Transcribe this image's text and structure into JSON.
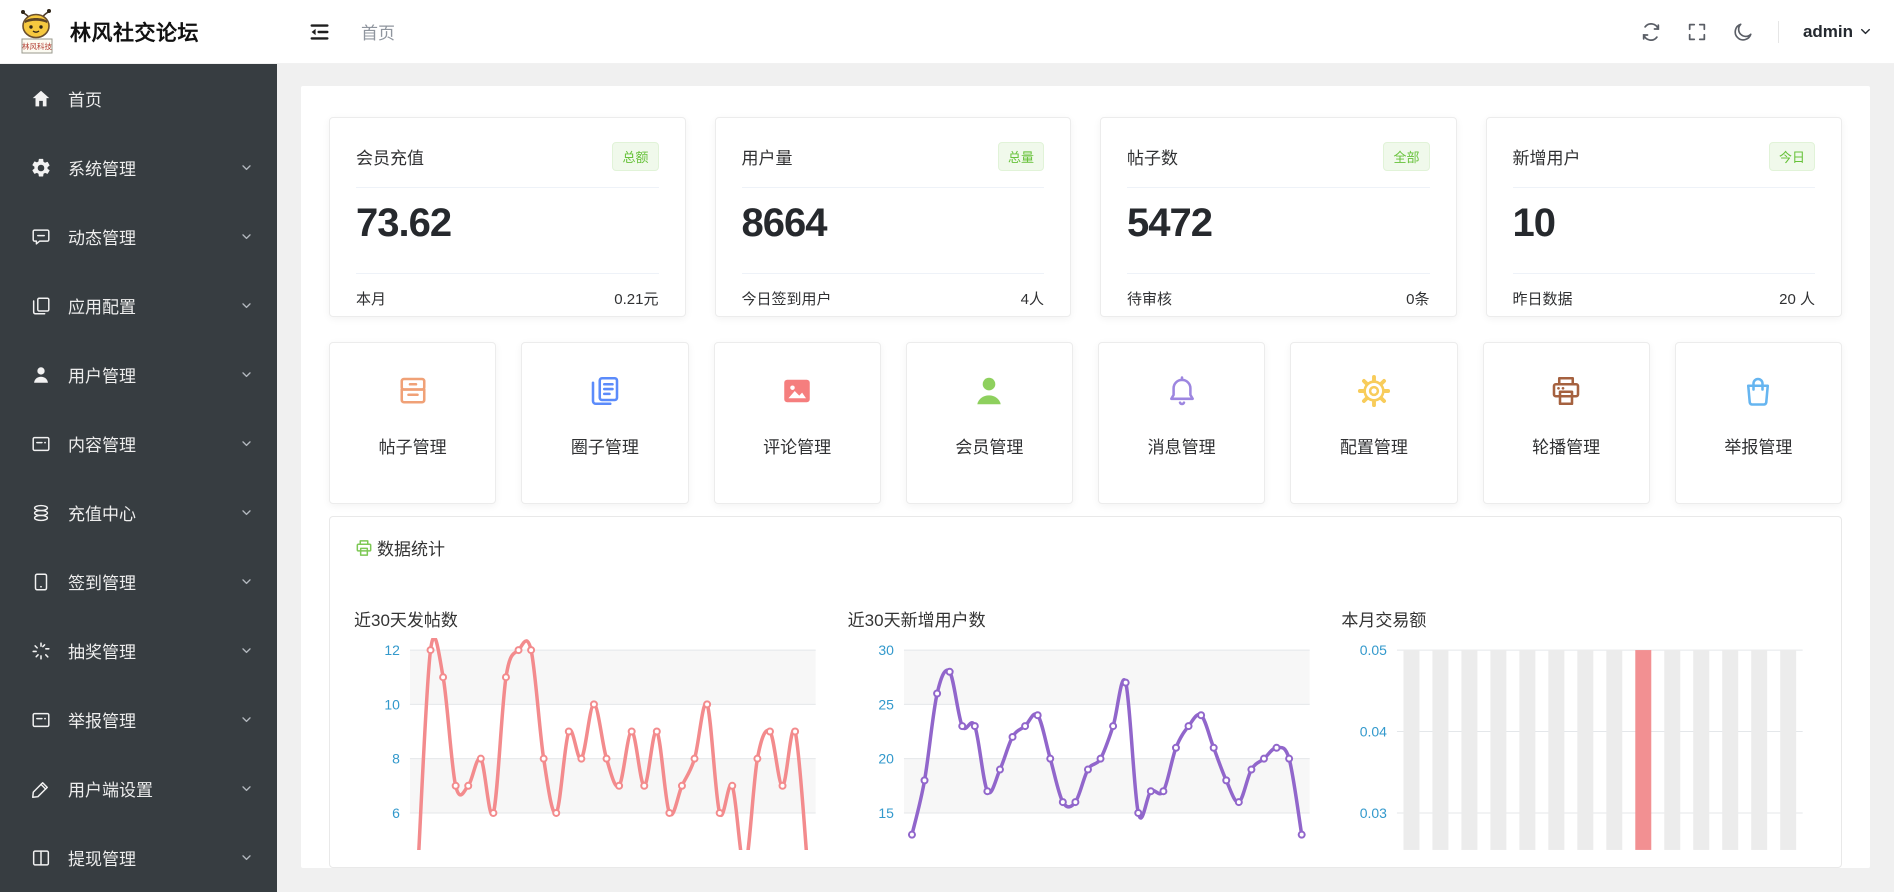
{
  "header": {
    "app_title": "林风社交论坛",
    "logo_tag": "林风科技",
    "breadcrumb": "首页",
    "username": "admin"
  },
  "sidebar": {
    "items": [
      {
        "key": "home",
        "label": "首页",
        "icon": "home",
        "expandable": false
      },
      {
        "key": "system",
        "label": "系统管理",
        "icon": "gear",
        "expandable": true
      },
      {
        "key": "dynamic",
        "label": "动态管理",
        "icon": "message",
        "expandable": true
      },
      {
        "key": "app-config",
        "label": "应用配置",
        "icon": "copy",
        "expandable": true
      },
      {
        "key": "users",
        "label": "用户管理",
        "icon": "user",
        "expandable": true
      },
      {
        "key": "content",
        "label": "内容管理",
        "icon": "form",
        "expandable": true
      },
      {
        "key": "recharge",
        "label": "充值中心",
        "icon": "coins",
        "expandable": true
      },
      {
        "key": "checkin",
        "label": "签到管理",
        "icon": "tablet",
        "expandable": true
      },
      {
        "key": "lottery",
        "label": "抽奖管理",
        "icon": "sparkle",
        "expandable": true
      },
      {
        "key": "report",
        "label": "举报管理",
        "icon": "form",
        "expandable": true
      },
      {
        "key": "client-settings",
        "label": "用户端设置",
        "icon": "pen",
        "expandable": true
      },
      {
        "key": "withdraw",
        "label": "提现管理",
        "icon": "book",
        "expandable": true
      }
    ]
  },
  "stats": [
    {
      "key": "member-recharge",
      "label": "会员充值",
      "badge": "总额",
      "value": "73.62",
      "foot_label": "本月",
      "foot_value": "0.21元"
    },
    {
      "key": "user-count",
      "label": "用户量",
      "badge": "总量",
      "value": "8664",
      "foot_label": "今日签到用户",
      "foot_value": "4人"
    },
    {
      "key": "post-count",
      "label": "帖子数",
      "badge": "全部",
      "value": "5472",
      "foot_label": "待审核",
      "foot_value": "0条"
    },
    {
      "key": "new-users",
      "label": "新增用户",
      "badge": "今日",
      "value": "10",
      "foot_label": "昨日数据",
      "foot_value": "20 人"
    }
  ],
  "shortcuts": [
    {
      "key": "posts",
      "label": "帖子管理",
      "icon": "archive",
      "color": "#f0a177"
    },
    {
      "key": "circles",
      "label": "圈子管理",
      "icon": "docs",
      "color": "#5b8bfb"
    },
    {
      "key": "comments",
      "label": "评论管理",
      "icon": "picture",
      "color": "#f57e7e"
    },
    {
      "key": "members",
      "label": "会员管理",
      "icon": "member",
      "color": "#8ed05e"
    },
    {
      "key": "messages",
      "label": "消息管理",
      "icon": "bell",
      "color": "#9d86e0"
    },
    {
      "key": "config",
      "label": "配置管理",
      "icon": "cog",
      "color": "#f8cc5a"
    },
    {
      "key": "carousel",
      "label": "轮播管理",
      "icon": "printer",
      "color": "#a5613f"
    },
    {
      "key": "reports",
      "label": "举报管理",
      "icon": "bag",
      "color": "#66b5f0"
    }
  ],
  "section": {
    "title": "数据统计",
    "accent": "#7dc855"
  },
  "chart_data": [
    {
      "type": "line",
      "title": "近30天发帖数",
      "color": "#f38b8d",
      "yticks": [
        12,
        10,
        8,
        6
      ],
      "grid": "alternating-bands",
      "x_axis_visible": false,
      "values": [
        4,
        12,
        11,
        7,
        7,
        8,
        6,
        11,
        12,
        12,
        8,
        6,
        9,
        8,
        10,
        8,
        7,
        9,
        7,
        9,
        6,
        7,
        8,
        10,
        6,
        7,
        4,
        8,
        9,
        7,
        9,
        4
      ]
    },
    {
      "type": "line",
      "title": "近30天新增用户数",
      "color": "#9166cb",
      "yticks": [
        30,
        25,
        20,
        15
      ],
      "grid": "alternating-bands",
      "x_axis_visible": false,
      "values": [
        13,
        18,
        26,
        28,
        23,
        23,
        17,
        19,
        22,
        23,
        24,
        20,
        16,
        16,
        19,
        20,
        23,
        27,
        15,
        17,
        17,
        21,
        23,
        24,
        21,
        18,
        16,
        19,
        20,
        21,
        20,
        13
      ]
    },
    {
      "type": "bar",
      "title": "本月交易额",
      "bar_color": "#ececec",
      "highlight_color": "#f29092",
      "highlight_index": 8,
      "yticks": [
        0.05,
        0.04,
        0.03
      ],
      "x_axis_visible": false,
      "values": [
        0.05,
        0.05,
        0.05,
        0.05,
        0.05,
        0.05,
        0.05,
        0.05,
        0.05,
        0.05,
        0.05,
        0.05,
        0.05,
        0.05
      ]
    }
  ]
}
